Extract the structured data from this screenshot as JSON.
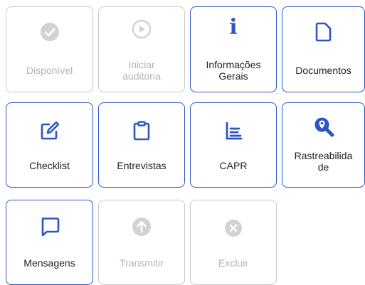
{
  "colors": {
    "accent": "#2a56c6",
    "disabled_border": "#c9c9c9",
    "disabled_text": "#b4b4b4",
    "disabled_icon": "#d2d2d2"
  },
  "tiles": [
    {
      "label": "Disponível",
      "icon": "check-circle-icon",
      "enabled": false
    },
    {
      "label": "Iniciar\nauditoria",
      "icon": "play-circle-icon",
      "enabled": false
    },
    {
      "label": "Informações\nGerais",
      "icon": "info-icon",
      "enabled": true
    },
    {
      "label": "Documentos",
      "icon": "document-icon",
      "enabled": true
    },
    {
      "label": "Checklist",
      "icon": "edit-icon",
      "enabled": true
    },
    {
      "label": "Entrevistas",
      "icon": "clipboard-icon",
      "enabled": true
    },
    {
      "label": "CAPR",
      "icon": "list-icon",
      "enabled": true
    },
    {
      "label": "Rastreabilida\nde",
      "icon": "search-location-icon",
      "enabled": true
    },
    {
      "label": "Mensagens",
      "icon": "message-icon",
      "enabled": true
    },
    {
      "label": "Transmitir",
      "icon": "upload-circle-icon",
      "enabled": false
    },
    {
      "label": "Excluir",
      "icon": "delete-circle-icon",
      "enabled": false
    }
  ]
}
